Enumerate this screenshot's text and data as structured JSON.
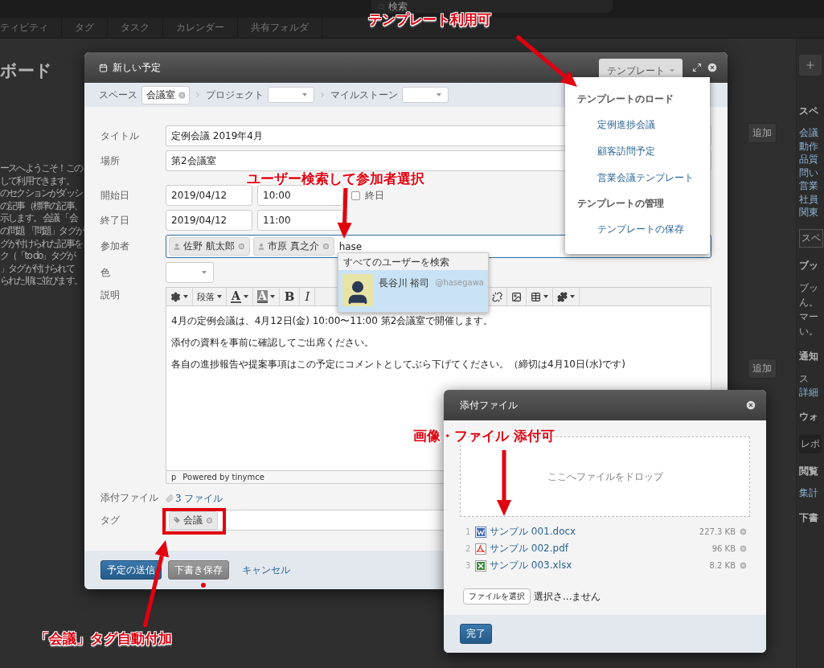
{
  "background": {
    "search_placeholder": "検索",
    "nav_tabs": [
      "ティビティ",
      "タグ",
      "タスク",
      "カレンダー",
      "共有フォルダ"
    ],
    "page_title": "ボード",
    "intro_lines": [
      "ースへようこそ！この",
      "して利用できます。",
      "のセクションがダッシ",
      "の記事（標準の記事、",
      "示します。 会議 「会",
      "の問題 「問題」タグが",
      "グが付けられた記事を",
      "ク（「to do」タグが",
      "」タグが付けられて",
      "られた順に並びます。"
    ],
    "add_buttons": [
      "追加",
      "追加"
    ],
    "side_panel": [
      {
        "kind": "heading",
        "text": "スペ"
      },
      {
        "kind": "link",
        "text": "会議"
      },
      {
        "kind": "link",
        "text": "動作"
      },
      {
        "kind": "link",
        "text": "品質"
      },
      {
        "kind": "link",
        "text": "問い"
      },
      {
        "kind": "link",
        "text": "営業"
      },
      {
        "kind": "link",
        "text": "社員"
      },
      {
        "kind": "link",
        "text": "関東"
      },
      {
        "kind": "select",
        "text": "スペ"
      },
      {
        "kind": "heading",
        "text": "ブッ"
      },
      {
        "kind": "text",
        "text": "ブッ"
      },
      {
        "kind": "text",
        "text": "ん。"
      },
      {
        "kind": "text",
        "text": "マー"
      },
      {
        "kind": "text",
        "text": "い。"
      },
      {
        "kind": "heading",
        "text": "通知"
      },
      {
        "kind": "text",
        "text": "ス"
      },
      {
        "kind": "link",
        "text": "詳細"
      },
      {
        "kind": "heading",
        "text": "ウォ"
      },
      {
        "kind": "button",
        "text": "レポ"
      },
      {
        "kind": "heading",
        "text": "閲覧"
      },
      {
        "kind": "link",
        "text": "集計"
      },
      {
        "kind": "heading",
        "text": "下書"
      }
    ]
  },
  "modal": {
    "title": "新しい予定",
    "template_button": "テンプレート",
    "space_bar": {
      "space_label": "スペース",
      "space": "会議室",
      "project_label": "プロジェクト",
      "milestone_label": "マイルストーン"
    },
    "fields": {
      "title_label": "タイトル",
      "title": "定例会議 2019年4月",
      "place_label": "場所",
      "place": "第2会議室",
      "start_label": "開始日",
      "start_date": "2019/04/12",
      "start_time": "10:00",
      "all_day_label": "終日",
      "all_day": false,
      "end_label": "終了日",
      "end_date": "2019/04/12",
      "end_time": "11:00",
      "participants_label": "参加者",
      "participants": [
        "佐野 航太郎",
        "市原 真之介"
      ],
      "participant_query": "hase",
      "color_label": "色",
      "description_label": "説明",
      "attachments_label": "添付ファイル",
      "attachments_link": "3 ファイル",
      "tags_label": "タグ",
      "tags": [
        "会議"
      ]
    },
    "editor": {
      "toolbar": [
        {
          "kind": "gear"
        },
        {
          "kind": "format",
          "text": "段落"
        },
        {
          "kind": "text-color",
          "text": "A"
        },
        {
          "kind": "highlight",
          "text": "A"
        },
        {
          "kind": "bold",
          "text": "B"
        },
        {
          "kind": "italic",
          "text": "I"
        }
      ],
      "toolbar_more": [
        {
          "kind": "unlink"
        },
        {
          "kind": "image"
        },
        {
          "kind": "table"
        },
        {
          "kind": "plugin"
        }
      ],
      "paragraphs": [
        "4月の定例会議は、4月12日(金) 10:00〜11:00 第2会議室で開催します。",
        "添付の資料を事前に確認してご出席ください。",
        "各自の進捗報告や提案事項はこの予定にコメントとしてぶら下げてください。（締切は4月10日(水)です)"
      ],
      "status_path": "p",
      "powered": "Powered by tinymce"
    },
    "buttons": [
      {
        "kind": "primary",
        "text": "予定の送信"
      },
      {
        "kind": "secondary",
        "text": "下書き保存"
      },
      {
        "kind": "link",
        "text": "キャンセル"
      }
    ]
  },
  "template_menu": [
    {
      "kind": "header",
      "text": "テンプレートのロード"
    },
    {
      "kind": "item",
      "text": "定例進捗会議"
    },
    {
      "kind": "item",
      "text": "顧客訪問予定"
    },
    {
      "kind": "item",
      "text": "営業会議テンプレート"
    },
    {
      "kind": "header",
      "text": "テンプレートの管理"
    },
    {
      "kind": "item",
      "text": "テンプレートの保存"
    }
  ],
  "user_search": {
    "header": "すべてのユーザーを検索",
    "results": [
      {
        "name": "長谷川 裕司",
        "handle": "@hasegawa",
        "selected": true
      }
    ]
  },
  "attachment_dialog": {
    "title": "添付ファイル",
    "drop_hint": "ここへファイルをドロップ",
    "files": [
      {
        "index": "1",
        "kind": "word",
        "name": "サンプル 001.docx",
        "size": "227.3 KB"
      },
      {
        "index": "2",
        "kind": "pdf",
        "name": "サンプル 002.pdf",
        "size": "96 KB"
      },
      {
        "index": "3",
        "kind": "excel",
        "name": "サンプル 003.xlsx",
        "size": "8.2 KB"
      }
    ],
    "choose_button": "ファイルを選択",
    "choose_status": "選択さ...ません",
    "done_button": "完了"
  },
  "annotations": [
    {
      "text": "テンプレート利用可"
    },
    {
      "text": "ユーザー検索して参加者選択"
    },
    {
      "text": "画像・ファイル 添付可"
    },
    {
      "text": "「会議」タグ自動付加"
    }
  ]
}
